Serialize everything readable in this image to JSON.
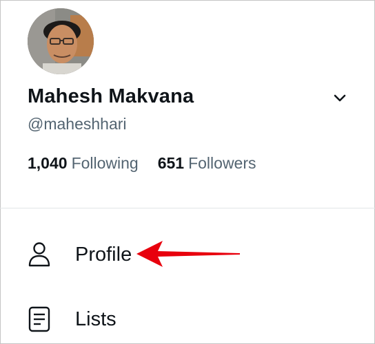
{
  "profile": {
    "name": "Mahesh Makvana",
    "handle": "@maheshhari",
    "following_count": "1,040",
    "following_label": "Following",
    "followers_count": "651",
    "followers_label": "Followers"
  },
  "menu": {
    "items": [
      {
        "label": "Profile",
        "icon": "person-icon"
      },
      {
        "label": "Lists",
        "icon": "list-icon"
      }
    ]
  },
  "colors": {
    "text": "#0f1419",
    "secondary_text": "#536471",
    "divider": "#e1e4e6",
    "annotation_arrow": "#e8000d"
  },
  "icons": {
    "account_switch": "chevron-down-icon",
    "annotation": "red-arrow-annotation"
  }
}
